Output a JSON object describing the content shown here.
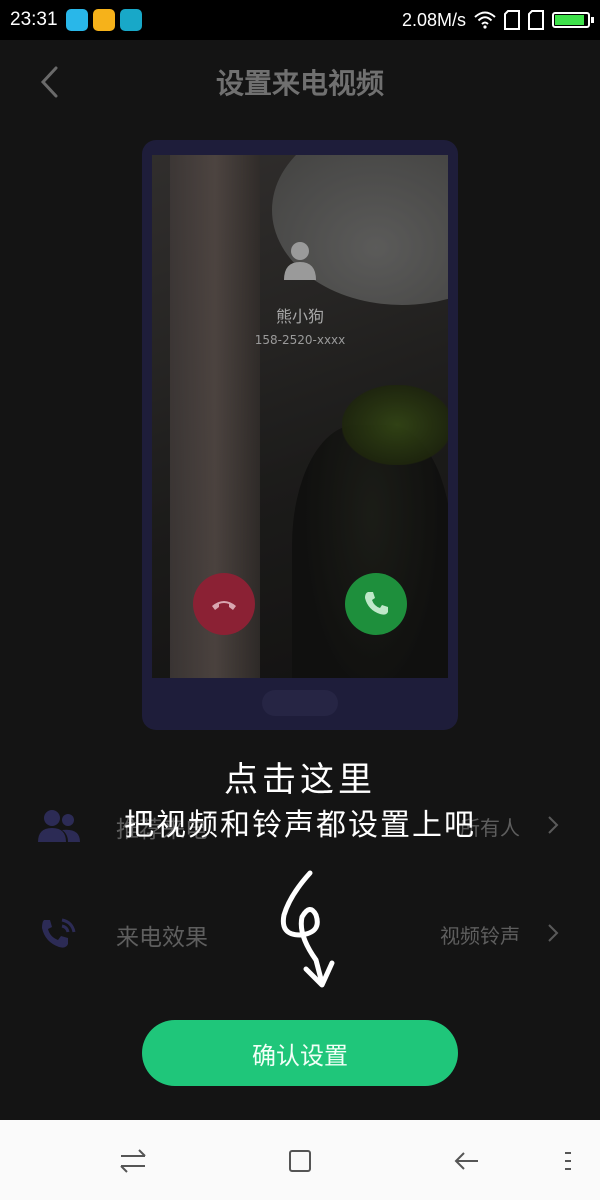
{
  "status_bar": {
    "time": "23:31",
    "network_speed": "2.08M/s",
    "battery_level": 0.85,
    "app_badge_colors": [
      "#29b7e9",
      "#f6b21a",
      "#18a8c8"
    ],
    "icons": [
      "wifi-icon",
      "sim1-icon",
      "sim2-icon",
      "battery-icon"
    ]
  },
  "header": {
    "title": "设置来电视频",
    "back_icon": "chevron-left-icon"
  },
  "preview": {
    "caller_name": "熊小狗",
    "caller_number": "158-2520-xxxx",
    "decline_color": "#8b2134",
    "accept_color": "#1e8f3c"
  },
  "settings": {
    "rows": [
      {
        "label": "推荐来电",
        "value": "所有人",
        "icon": "contacts-icon"
      },
      {
        "label": "来电效果",
        "value": "视频铃声",
        "icon": "phone-ring-icon"
      }
    ]
  },
  "overlay": {
    "line1": "点击这里",
    "line2": "把视频和铃声都设置上吧"
  },
  "confirm_button": {
    "label": "确认设置",
    "color": "#1fc67a"
  },
  "nav_bar": {
    "icons": [
      "switch-icon",
      "home-square-icon",
      "back-arrow-icon",
      "menu-icon"
    ]
  }
}
